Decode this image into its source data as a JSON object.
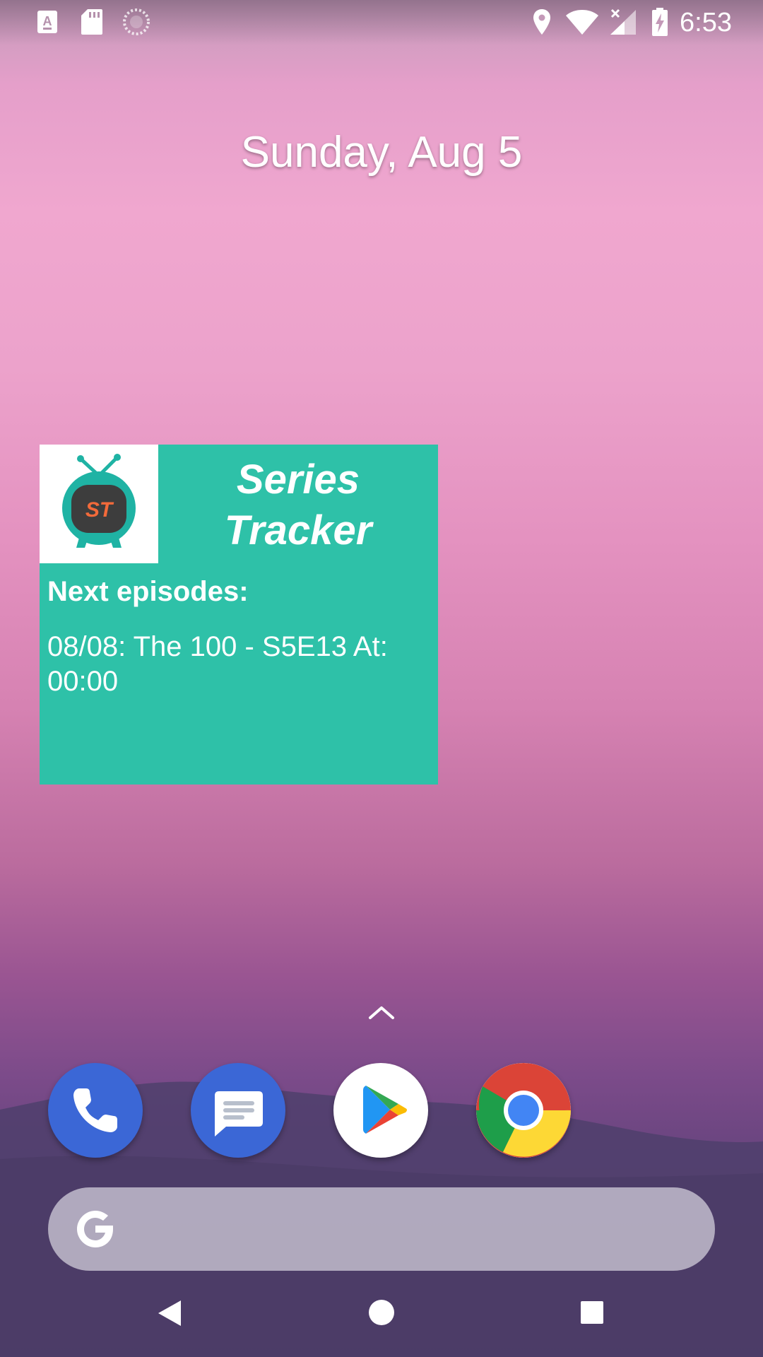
{
  "status_bar": {
    "time": "6:53",
    "left_icons": [
      "notification-a-icon",
      "sd-card-icon",
      "sync-icon"
    ],
    "right_icons": [
      "location-icon",
      "wifi-icon",
      "cell-signal-off-icon",
      "battery-charging-icon"
    ]
  },
  "home": {
    "date": "Sunday, Aug 5"
  },
  "widget": {
    "title": "Series Tracker",
    "subheading": "Next episodes:",
    "episode": "08/08: The 100 - S5E13 At: 00:00",
    "logo_text": "ST",
    "colors": {
      "background": "#2ec1a8",
      "logo_tv": "#1fb3a4",
      "logo_screen": "#3d3d3d",
      "logo_text": "#f26a3a"
    }
  },
  "dock": {
    "apps": [
      "Phone",
      "Messages",
      "Play Store",
      "Chrome"
    ]
  },
  "search": {
    "placeholder": ""
  },
  "nav_bar": {
    "buttons": [
      "back",
      "home",
      "recents"
    ]
  }
}
